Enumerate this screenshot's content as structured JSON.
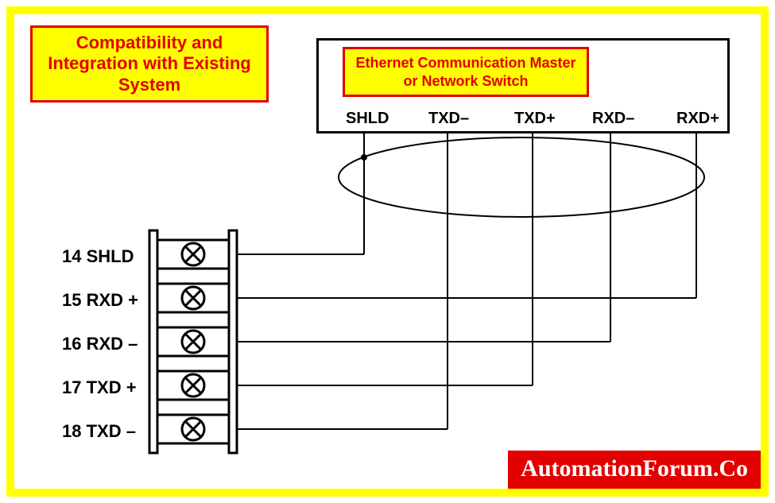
{
  "title": "Compatibility and Integration with Existing System",
  "device": {
    "label": "Ethernet Communication Master or Network Switch",
    "pins": [
      "SHLD",
      "TXD–",
      "TXD+",
      "RXD–",
      "RXD+"
    ]
  },
  "terminals": [
    {
      "num": "14",
      "name": "SHLD"
    },
    {
      "num": "15",
      "name": "RXD +"
    },
    {
      "num": "16",
      "name": "RXD –"
    },
    {
      "num": "17",
      "name": "TXD +"
    },
    {
      "num": "18",
      "name": "TXD –"
    }
  ],
  "watermark": "AutomationForum.Co"
}
